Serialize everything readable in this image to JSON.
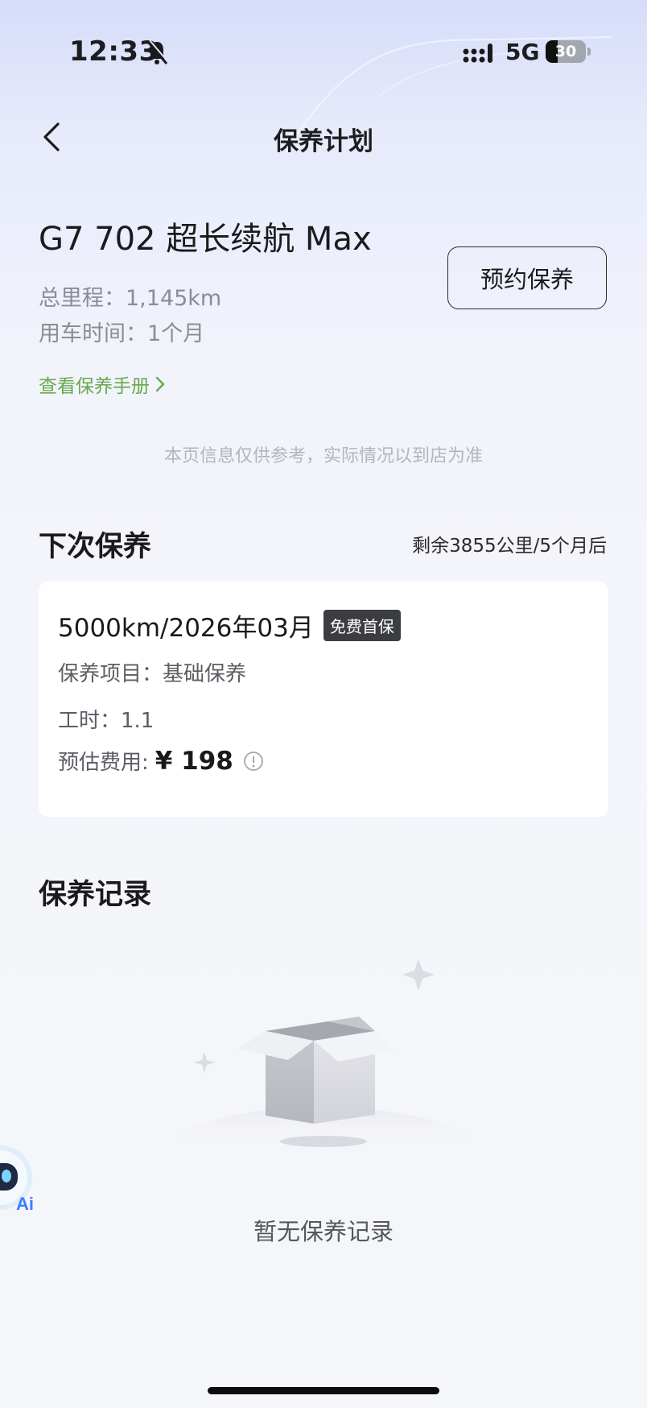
{
  "status_bar": {
    "time": "12:33",
    "network": "5G",
    "battery": "30",
    "battery_fraction": 0.3
  },
  "nav": {
    "title": "保养计划",
    "back_icon": "chevron-left-icon"
  },
  "vehicle": {
    "name": "G7 702 超长续航 Max",
    "mileage": "总里程：1,145km",
    "usage_time": "用车时间：1个月",
    "book_button": "预约保养",
    "manual_link": "查看保养手册"
  },
  "disclaimer": "本页信息仅供参考，实际情况以到店为准",
  "next_maintenance": {
    "title": "下次保养",
    "remaining": "剩余3855公里/5个月后",
    "target": "5000km/2026年03月",
    "badge": "免费首保",
    "items": "保养项目：基础保养",
    "labor_hours": "工时：1.1",
    "cost_label": "预估费用:",
    "cost_value": "¥ 198"
  },
  "records": {
    "title": "保养记录",
    "empty_text": "暂无保养记录"
  },
  "ai_assistant": {
    "label": "Ai"
  },
  "colors": {
    "accent_green": "#6aa84f",
    "badge_bg": "#3b3d43",
    "ai_blue": "#3b7bff"
  }
}
